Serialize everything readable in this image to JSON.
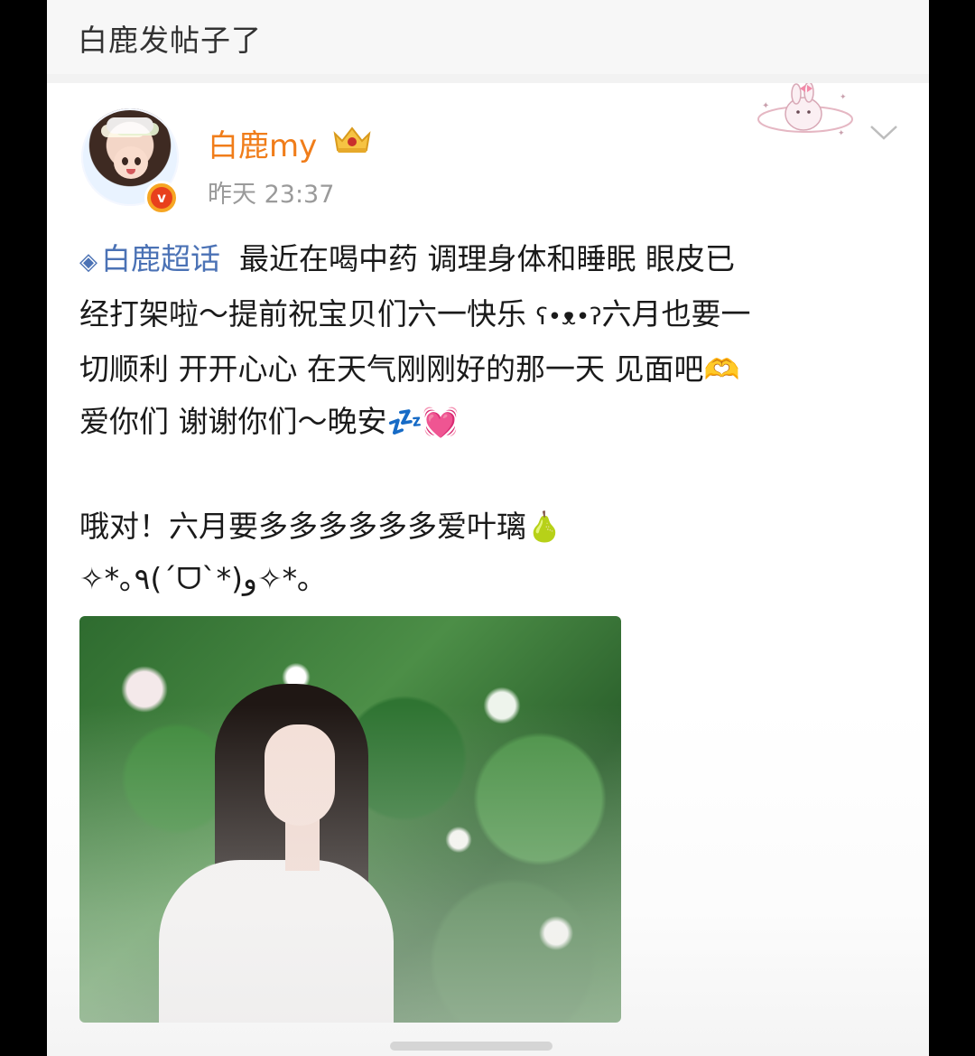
{
  "header": {
    "title": "白鹿发帖子了"
  },
  "post": {
    "author": "白鹿my",
    "time": "昨天 23:37",
    "topic": "白鹿超话",
    "line1": "  最近在喝中药 调理身体和睡眠 眼皮已",
    "line2": "经打架啦～提前祝宝贝们六一快乐 ",
    "line2b": "ʕ•ᴥ•ʔ",
    "line2c": "六月也要一",
    "line3": "切顺利 开开心心 在天气刚刚好的那一天 见面吧",
    "line3_emoji": "🫶",
    "line4": "爱你们 谢谢你们～晚安",
    "line4_emoji": "💤💓",
    "line5": "哦对！六月要多多多多多多爱叶璃",
    "line5_emoji": "🍐",
    "line6": "✧*｡٩(ˊᗜˋ*)و✧*｡"
  },
  "icons": {
    "crown": "crown-icon",
    "verified": "verified-badge-icon",
    "chevron": "chevron-down-icon",
    "topic": "diamond-icon"
  },
  "colors": {
    "username": "#f07d1a",
    "topic": "#4b72b5",
    "timestamp": "#9a9a9a"
  }
}
